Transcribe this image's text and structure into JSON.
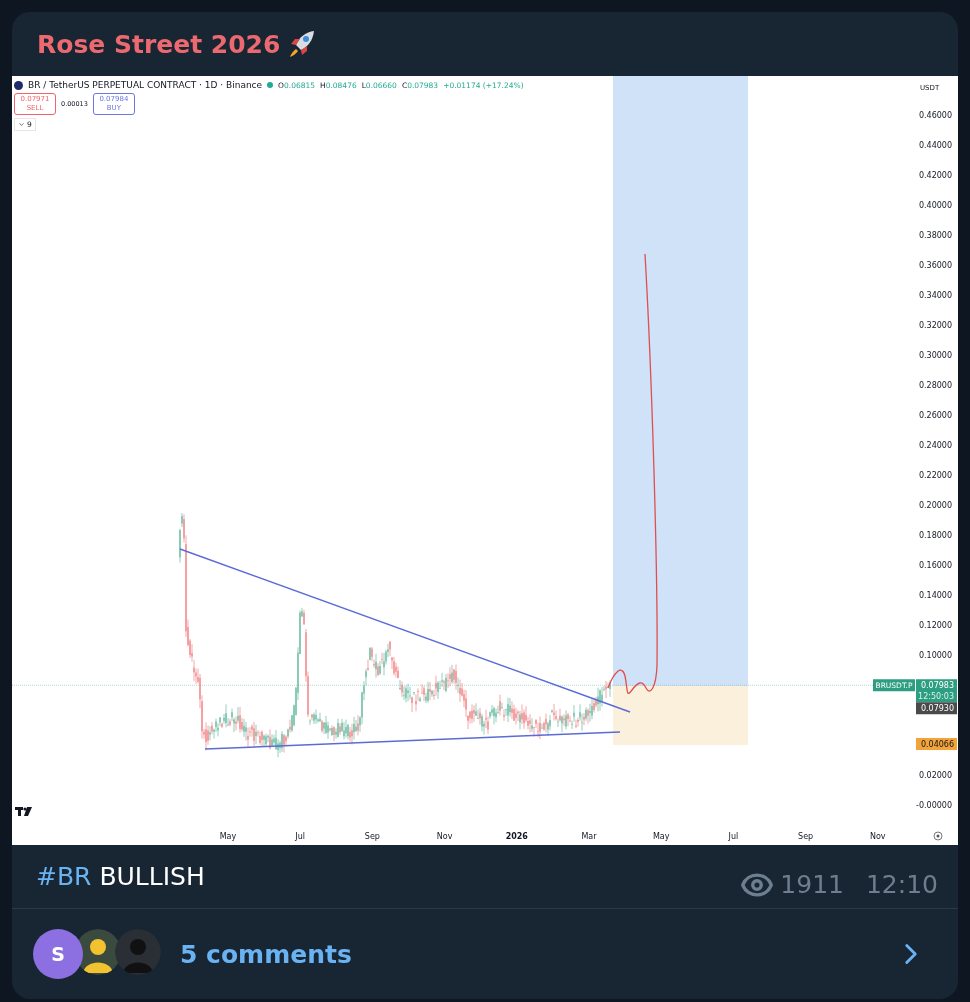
{
  "post": {
    "title": "Rose Street 2026"
  },
  "chart": {
    "symbol": "BR / TetherUS PERPETUAL CONTRACT · 1D · Binance",
    "ohlc": [
      {
        "label": "O",
        "value": "0.06815"
      },
      {
        "label": "H",
        "value": "0.08476"
      },
      {
        "label": "L",
        "value": "0.06660"
      },
      {
        "label": "C",
        "value": "0.07983"
      }
    ],
    "change": "+0.01174 (+17.24%)",
    "sell": {
      "price": "0.07971",
      "label": "SELL"
    },
    "spread": "0.00013",
    "buy": {
      "price": "0.07984",
      "label": "BUY"
    },
    "indicators_count": "9",
    "currency": "USDT",
    "price_ticks": [
      "0.46000",
      "0.44000",
      "0.42000",
      "0.40000",
      "0.38000",
      "0.36000",
      "0.34000",
      "0.32000",
      "0.30000",
      "0.28000",
      "0.26000",
      "0.24000",
      "0.22000",
      "0.20000",
      "0.18000",
      "0.16000",
      "0.14000",
      "0.12000",
      "0.10000",
      "0.02000",
      "-0.00000"
    ],
    "time_ticks": [
      {
        "label": "May",
        "bold": false
      },
      {
        "label": "Jul",
        "bold": false
      },
      {
        "label": "Sep",
        "bold": false
      },
      {
        "label": "Nov",
        "bold": false
      },
      {
        "label": "2026",
        "bold": true
      },
      {
        "label": "Mar",
        "bold": false
      },
      {
        "label": "May",
        "bold": false
      },
      {
        "label": "Jul",
        "bold": false
      },
      {
        "label": "Sep",
        "bold": false
      },
      {
        "label": "Nov",
        "bold": false
      }
    ],
    "symbol_tag": "BRUSDT.P",
    "last_price": "0.07983",
    "countdown": "12:50:03",
    "price_labels": [
      {
        "kind": "dark",
        "value": "0.07930"
      },
      {
        "kind": "orange",
        "value": "0.04066"
      }
    ]
  },
  "caption": {
    "hashtag": "#BR",
    "text": "BULLISH"
  },
  "views": "1911",
  "time": "12:10",
  "comments": {
    "avatars": [
      {
        "kind": "letter",
        "letter": "S",
        "color": "#8c6fe0"
      },
      {
        "kind": "picture"
      },
      {
        "kind": "picture"
      }
    ],
    "label": "5 comments"
  }
}
